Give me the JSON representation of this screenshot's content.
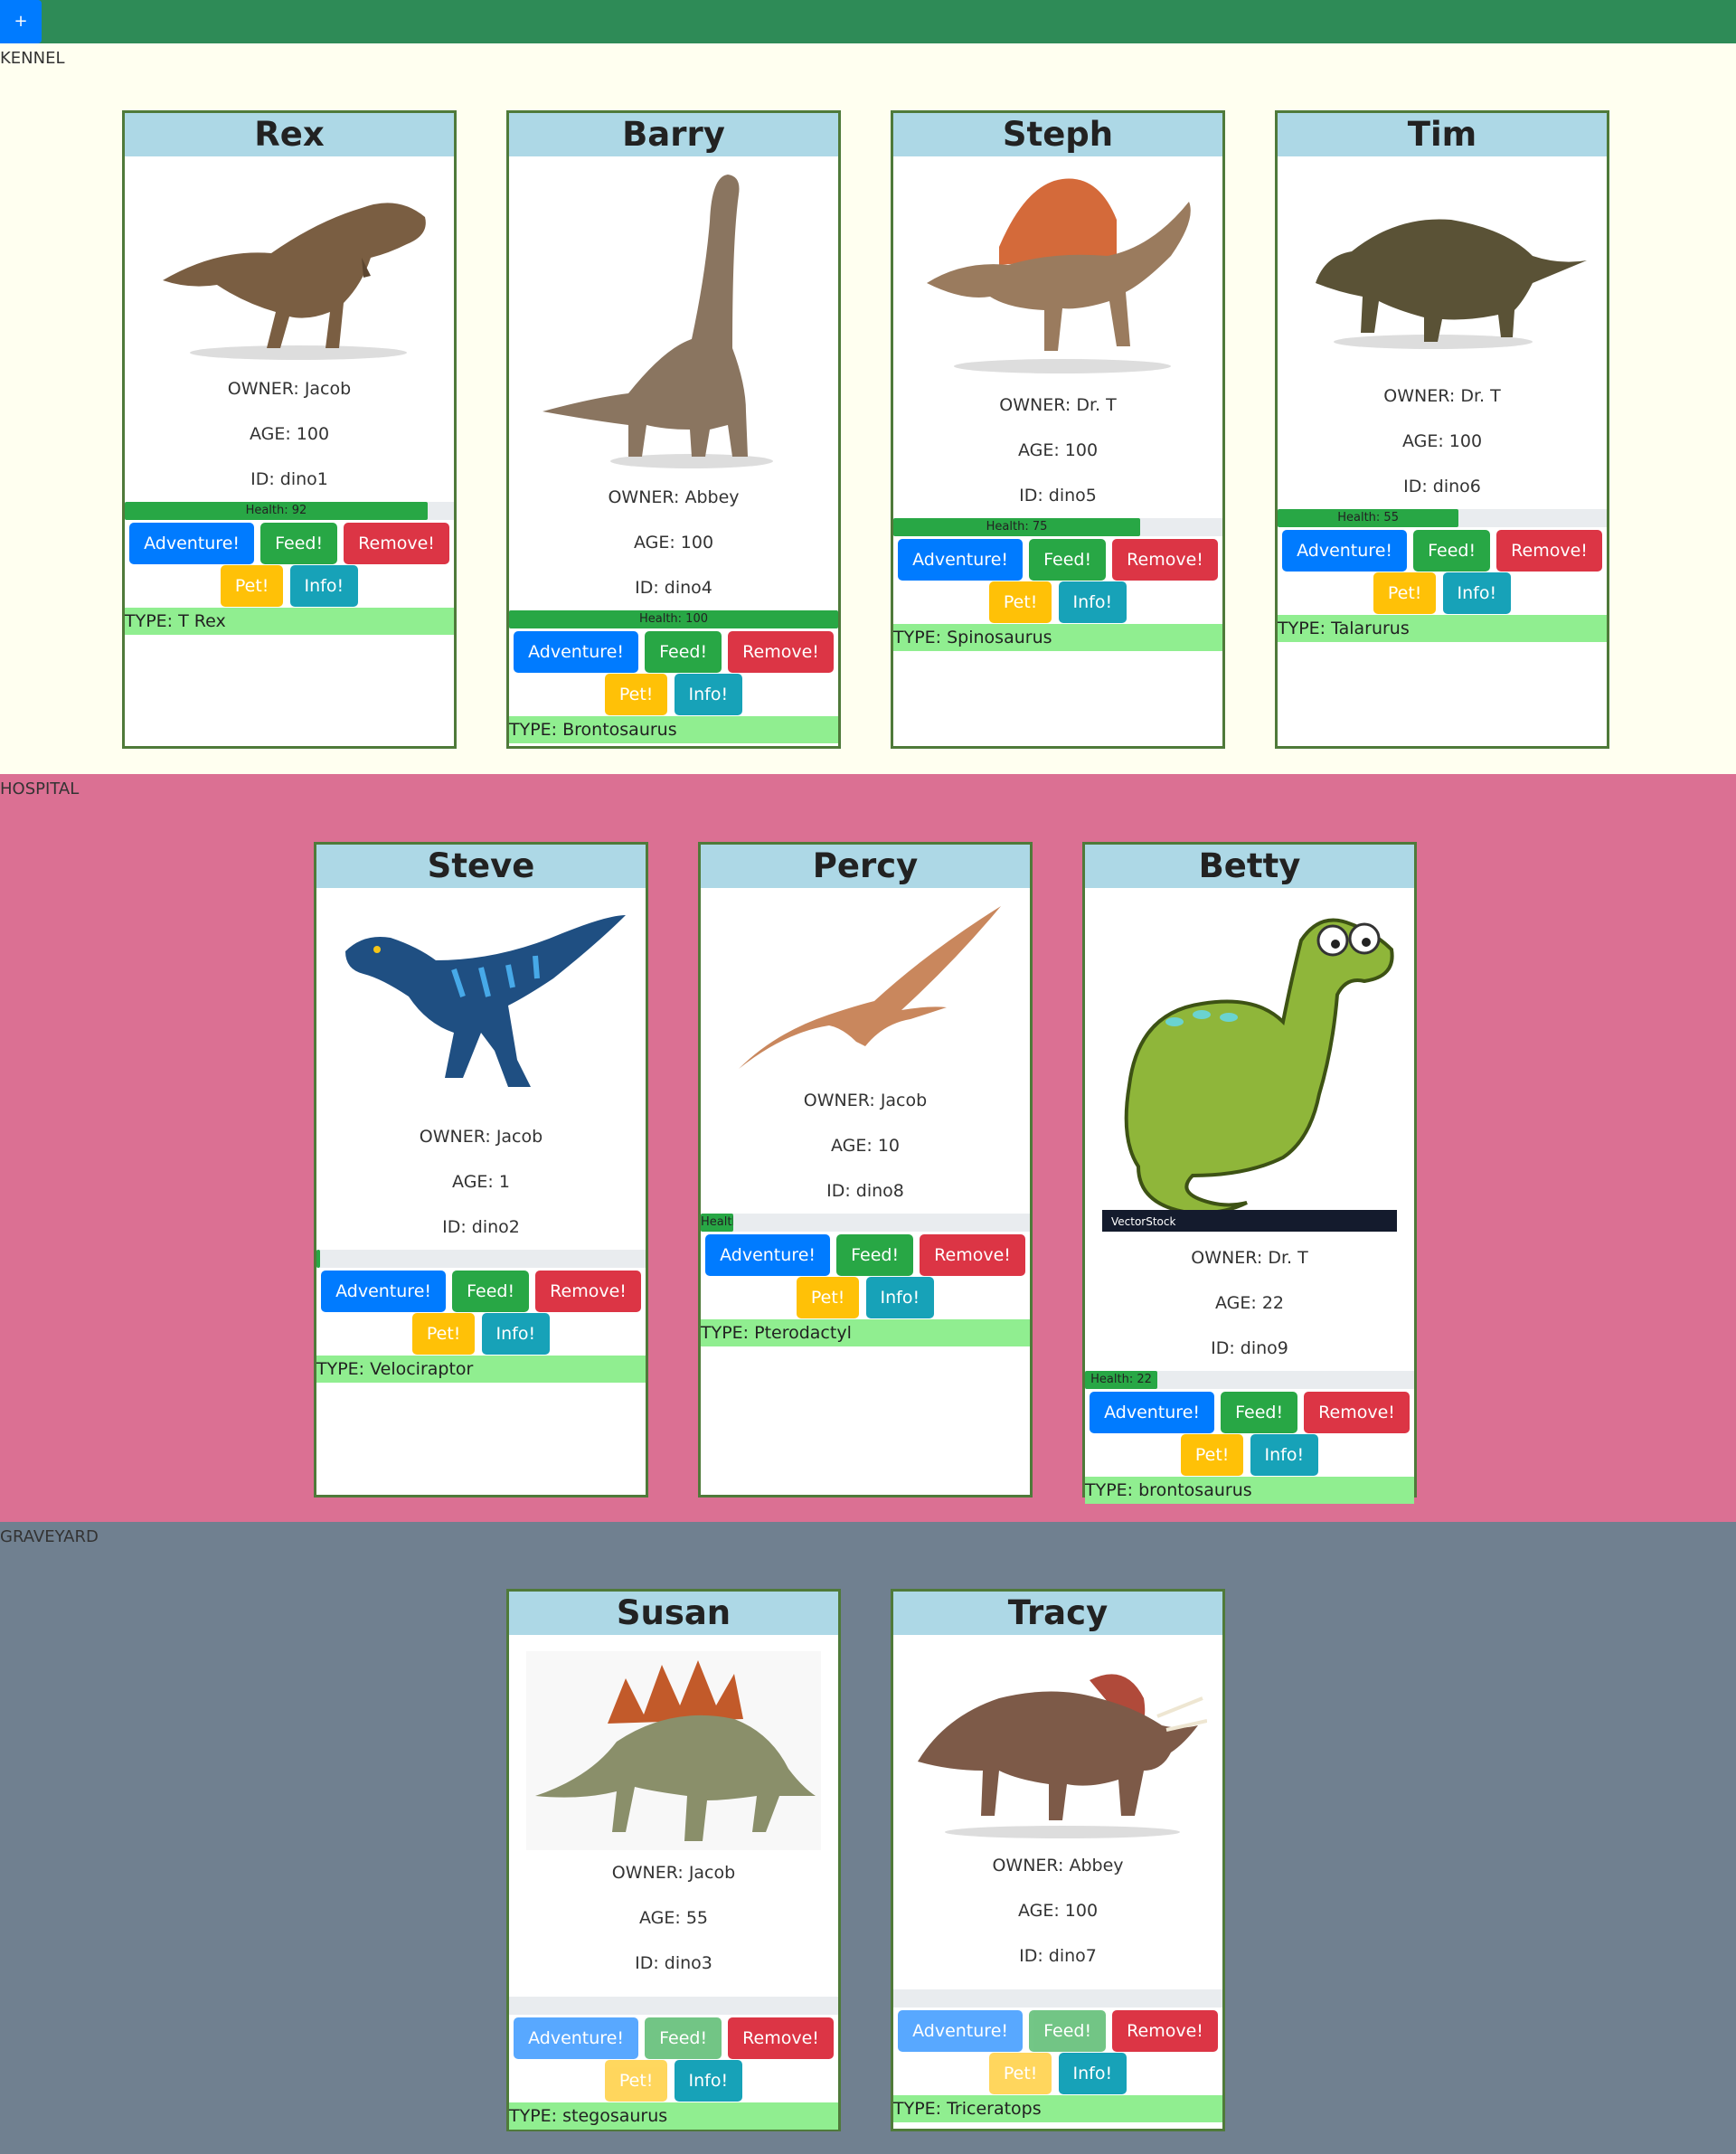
{
  "toolbar": {
    "add_label": "+"
  },
  "sections": {
    "kennel": "KENNEL",
    "hospital": "HOSPITAL",
    "graveyard": "GRAVEYARD"
  },
  "buttons": {
    "adventure": "Adventure!",
    "feed": "Feed!",
    "remove": "Remove!",
    "pet": "Pet!",
    "info": "Info!"
  },
  "colors": {
    "topbar": "#2e8b57",
    "kennel_bg": "#fffff0",
    "hospital_bg": "#db7093",
    "graveyard_bg": "#708090",
    "card_header": "#add8e6",
    "type_bar": "#90ee90",
    "health_bar": "#28a745"
  },
  "dinos": [
    {
      "name": "Rex",
      "owner": "OWNER: Jacob",
      "age": "AGE: 100",
      "id": "ID: dino1",
      "health": 92,
      "health_label": "Health: 92",
      "type": "TYPE: T Rex",
      "image": "t-rex-image"
    },
    {
      "name": "Barry",
      "owner": "OWNER: Abbey",
      "age": "AGE: 100",
      "id": "ID: dino4",
      "health": 100,
      "health_label": "Health: 100",
      "type": "TYPE: Brontosaurus",
      "image": "brontosaurus-image"
    },
    {
      "name": "Steph",
      "owner": "OWNER: Dr. T",
      "age": "AGE: 100",
      "id": "ID: dino5",
      "health": 75,
      "health_label": "Health: 75",
      "type": "TYPE: Spinosaurus",
      "image": "spinosaurus-image"
    },
    {
      "name": "Tim",
      "owner": "OWNER: Dr. T",
      "age": "AGE: 100",
      "id": "ID: dino6",
      "health": 55,
      "health_label": "Health: 55",
      "type": "TYPE: Talarurus",
      "image": "talarurus-image"
    },
    {
      "name": "Steve",
      "owner": "OWNER: Jacob",
      "age": "AGE: 1",
      "id": "ID: dino2",
      "health": 1,
      "health_label": "",
      "type": "TYPE: Velociraptor",
      "image": "velociraptor-image"
    },
    {
      "name": "Percy",
      "owner": "OWNER: Jacob",
      "age": "AGE: 10",
      "id": "ID: dino8",
      "health": 10,
      "health_label": "Health",
      "type": "TYPE: Pterodactyl",
      "image": "pterodactyl-image"
    },
    {
      "name": "Betty",
      "owner": "OWNER: Dr. T",
      "age": "AGE: 22",
      "id": "ID: dino9",
      "health": 22,
      "health_label": "Health: 22",
      "type": "TYPE: brontosaurus",
      "image": "cartoon-dinosaur-image",
      "watermark": "VectorStock"
    },
    {
      "name": "Susan",
      "owner": "OWNER: Jacob",
      "age": "AGE: 55",
      "id": "ID: dino3",
      "health": 0,
      "health_label": "",
      "type": "TYPE: stegosaurus",
      "image": "stegosaurus-image"
    },
    {
      "name": "Tracy",
      "owner": "OWNER: Abbey",
      "age": "AGE: 100",
      "id": "ID: dino7",
      "health": 0,
      "health_label": "",
      "type": "TYPE: Triceratops",
      "image": "triceratops-image"
    }
  ]
}
